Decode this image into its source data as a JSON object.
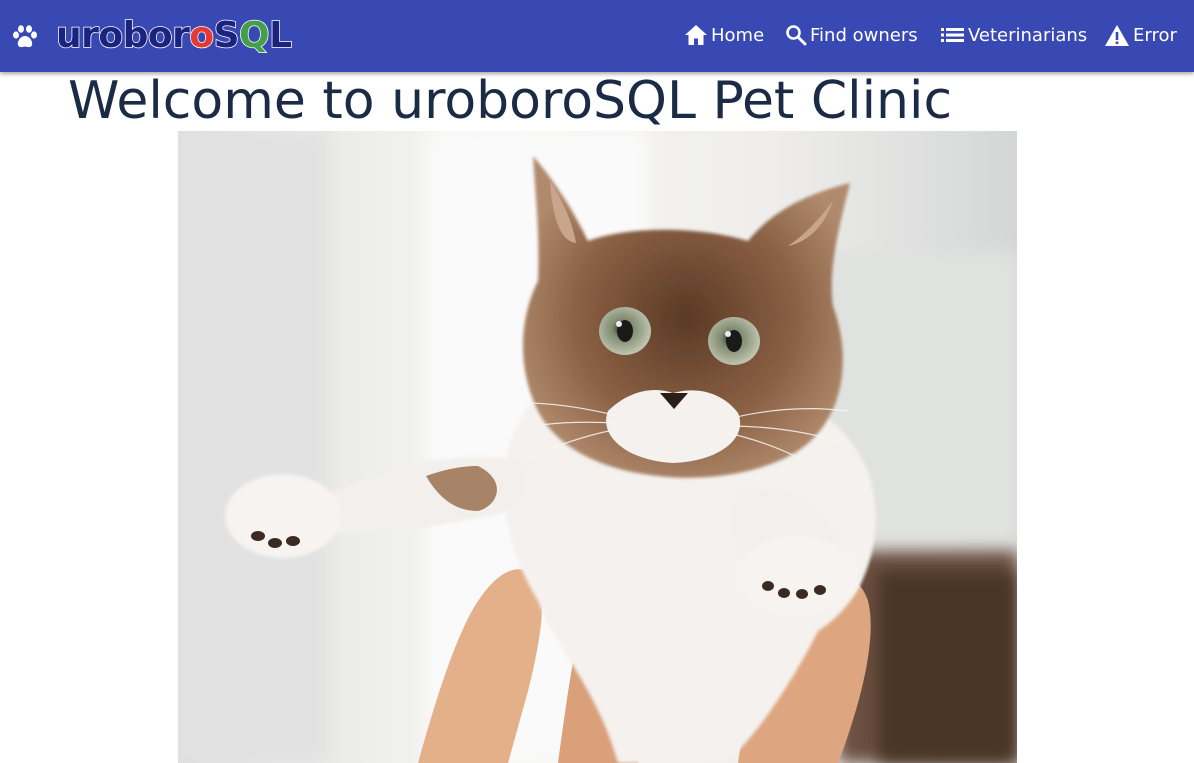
{
  "brand": {
    "icon": "paw-icon",
    "logo_part1": "urobor",
    "logo_part2": "o",
    "logo_part3": "S",
    "logo_part4": "Q",
    "logo_part5": "L",
    "colors": {
      "navbar": "#3949b4",
      "logo_text": "#1a2380",
      "logo_accent_red": "#e53935",
      "logo_accent_green": "#43a047"
    }
  },
  "nav": {
    "items": [
      {
        "label": "Home",
        "icon": "home-icon"
      },
      {
        "label": "Find owners",
        "icon": "search-icon"
      },
      {
        "label": "Veterinarians",
        "icon": "list-icon"
      },
      {
        "label": "Error",
        "icon": "warning-icon"
      }
    ]
  },
  "main": {
    "title": "Welcome to uroboroSQL Pet Clinic",
    "hero_image": "cat held up by hands"
  }
}
